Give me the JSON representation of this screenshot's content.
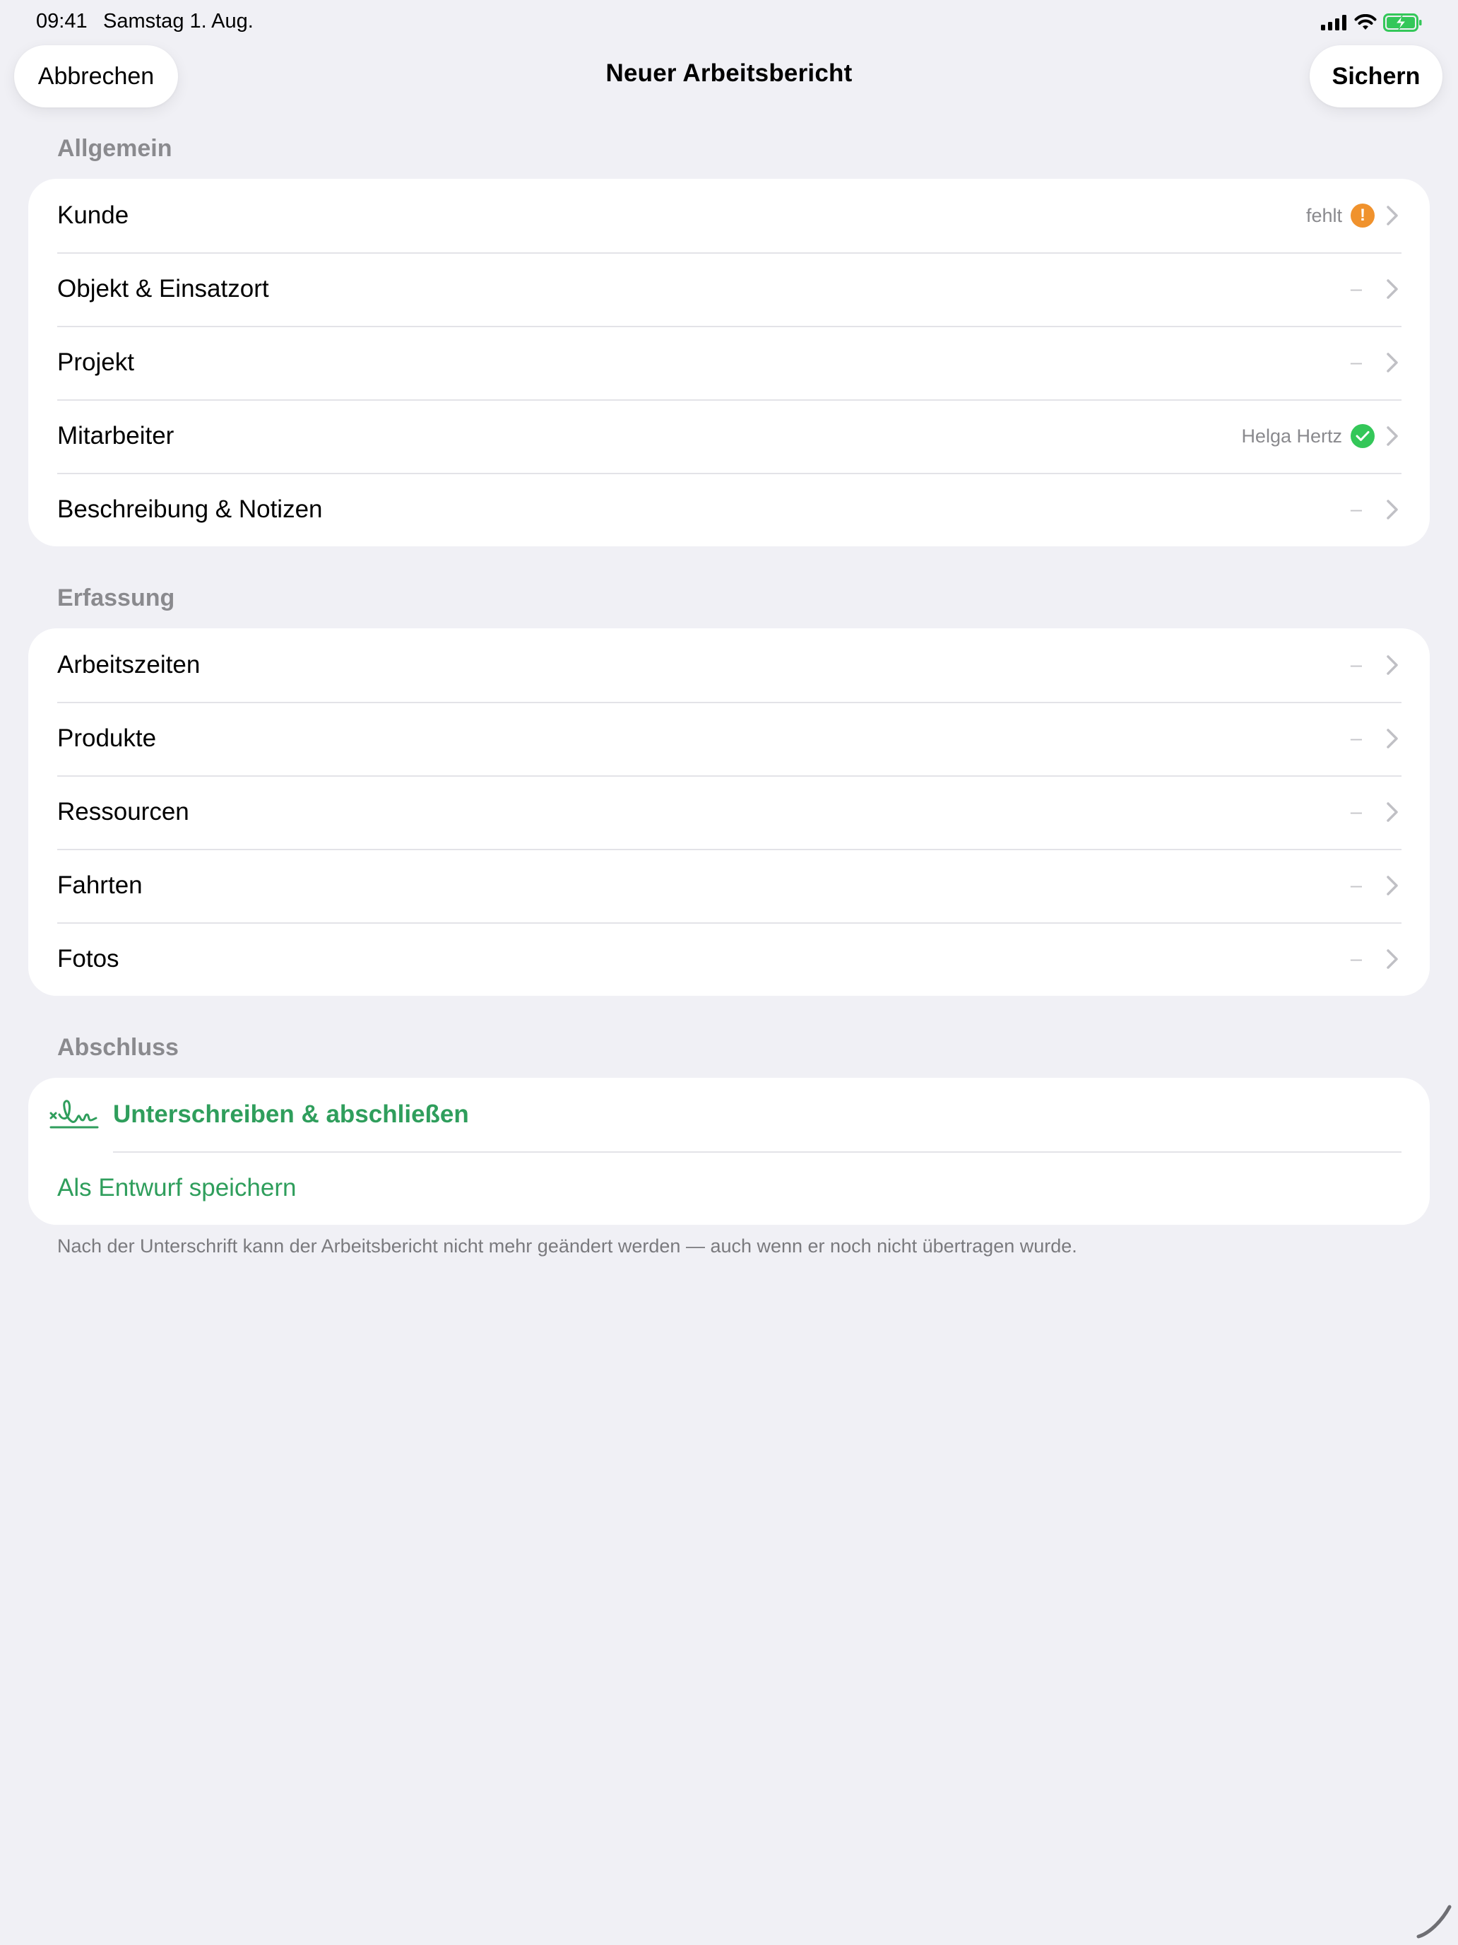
{
  "status_bar": {
    "time": "09:41",
    "date": "Samstag 1. Aug."
  },
  "nav": {
    "cancel_label": "Abbrechen",
    "title": "Neuer Arbeitsbericht",
    "save_label": "Sichern"
  },
  "sections": {
    "allgemein": {
      "header": "Allgemein",
      "rows": [
        {
          "label": "Kunde",
          "value": "fehlt",
          "status": "warning"
        },
        {
          "label": "Objekt & Einsatzort",
          "value": "–"
        },
        {
          "label": "Projekt",
          "value": "–"
        },
        {
          "label": "Mitarbeiter",
          "value": "Helga Hertz",
          "status": "ok"
        },
        {
          "label": "Beschreibung & Notizen",
          "value": "–"
        }
      ]
    },
    "erfassung": {
      "header": "Erfassung",
      "rows": [
        {
          "label": "Arbeitszeiten",
          "value": "–"
        },
        {
          "label": "Produkte",
          "value": "–"
        },
        {
          "label": "Ressourcen",
          "value": "–"
        },
        {
          "label": "Fahrten",
          "value": "–"
        },
        {
          "label": "Fotos",
          "value": "–"
        }
      ]
    },
    "abschluss": {
      "header": "Abschluss",
      "sign_label": "Unterschreiben & abschließen",
      "draft_label": "Als Entwurf speichern",
      "footnote": "Nach der Unterschrift kann der Arbeitsbericht nicht mehr geändert werden — auch wenn er noch nicht übertragen wurde."
    }
  },
  "colors": {
    "background": "#f0f0f5",
    "accent_green": "#2f9e5c",
    "warning_orange": "#f0922d",
    "ok_green": "#34c759",
    "secondary_text": "#8a8a8e"
  },
  "icons": {
    "warning_badge": "exclamation-mark",
    "ok_badge": "checkmark-icon",
    "row_chevron": "chevron-right-icon",
    "sign": "signature-icon"
  }
}
